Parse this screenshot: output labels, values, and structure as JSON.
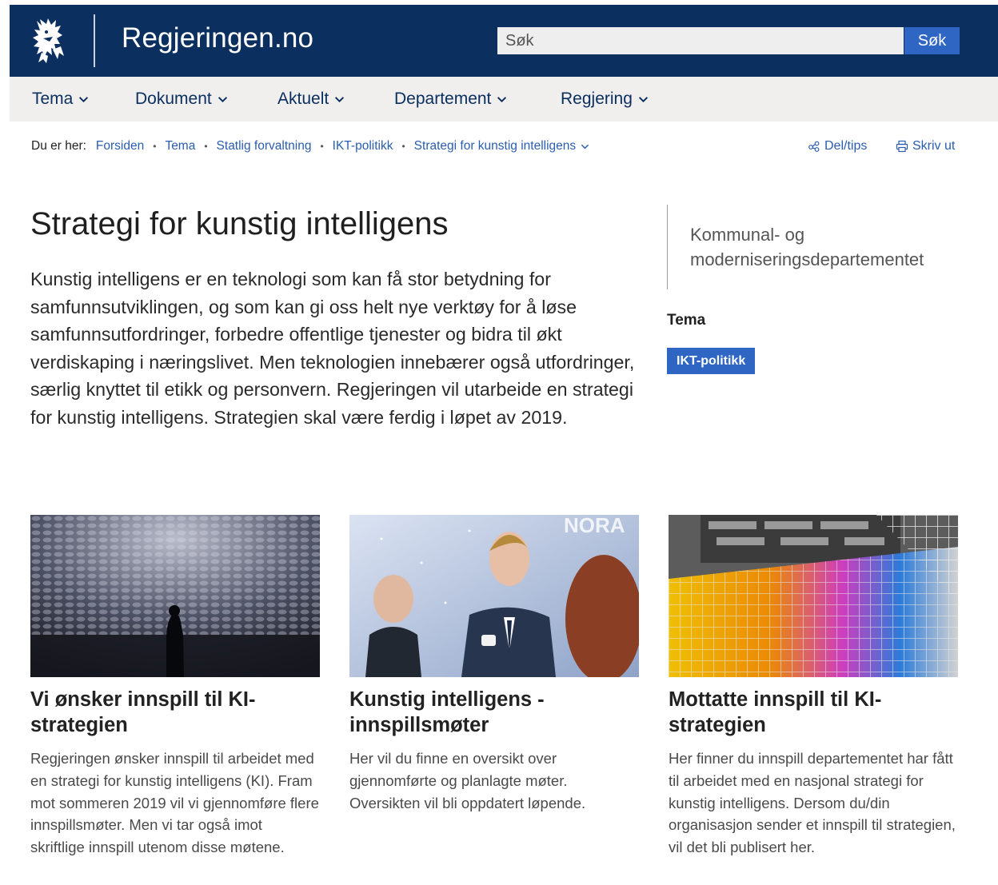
{
  "header": {
    "site_name": "Regjeringen.no",
    "logo_icon": "norwegian-lion-icon",
    "search_placeholder": "Søk",
    "search_button_label": "Søk"
  },
  "nav": {
    "items": [
      {
        "label": "Tema"
      },
      {
        "label": "Dokument"
      },
      {
        "label": "Aktuelt"
      },
      {
        "label": "Departement"
      },
      {
        "label": "Regjering"
      }
    ]
  },
  "breadcrumb": {
    "lead": "Du er her:",
    "items": [
      "Forsiden",
      "Tema",
      "Statlig forvaltning",
      "IKT-politikk",
      "Strategi for kunstig intelligens"
    ]
  },
  "tools": {
    "share_label": "Del/tips",
    "print_label": "Skriv ut"
  },
  "main": {
    "title": "Strategi for kunstig intelligens",
    "lead": "Kunstig intelligens er en teknologi som kan få stor betydning for samfunnsutviklingen, og som kan gi oss helt nye verktøy for å løse samfunnsutfordringer, forbedre offentlige tjenester og bidra til økt verdiskaping i næringslivet. Men teknologien innebærer også utfordringer, særlig knyttet til etikk og personvern. Regjeringen vil utarbeide en strategi for kunstig intelligens. Strategien skal være ferdig i løpet av 2019."
  },
  "aside": {
    "ministry": "Kommunal- og moderniseringsdepartementet",
    "tema_heading": "Tema",
    "tema_tag": "IKT-politikk"
  },
  "cards": [
    {
      "title": "Vi ønsker innspill til KI-strategien",
      "text": "Regjeringen ønsker innspill til arbeidet med en strategi for kunstig intelligens (KI). Fram mot sommeren 2019 vil vi gjennomføre flere innspillsmøter. Men vi tar også imot skriftlige innspill utenom disse møtene."
    },
    {
      "title": "Kunstig intelligens - innspillsmøter",
      "text": "Her vil du finne en oversikt over gjennomførte og planlagte møter. Oversikten vil bli oppdatert løpende.",
      "image_text": "NORA"
    },
    {
      "title": "Mottatte innspill til KI-strategien",
      "text": "Her finner du innspill departementet har fått til arbeidet med en nasjonal strategi for kunstig intelligens. Dersom du/din organisasjon sender et innspill til strategien, vil det bli publisert her."
    }
  ],
  "colors": {
    "header_bg": "#0b3060",
    "nav_bg": "#f0efed",
    "accent": "#2f66c4",
    "link": "#2a5db0"
  }
}
